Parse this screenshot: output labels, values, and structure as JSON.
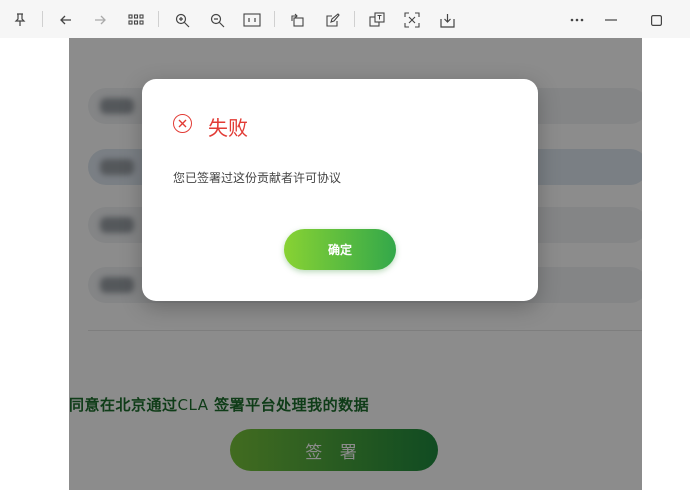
{
  "app": {
    "toolbar_icons": [
      "pin-icon",
      "back-arrow-icon",
      "forward-arrow-icon",
      "grid-icon",
      "zoom-in-icon",
      "zoom-out-icon",
      "actual-size-icon",
      "rotate-icon",
      "edit-icon",
      "translate-icon",
      "ocr-icon",
      "save-icon",
      "more-icon",
      "maximize-icon"
    ]
  },
  "page": {
    "consent_text_prefix": "同意在北京通过",
    "consent_text_cla": "CLA",
    "consent_text_suffix": " 签署平台处理我的数据",
    "sign_button_label": "签 署"
  },
  "dialog": {
    "title": "失败",
    "message": "您已签署过这份贡献者许可协议",
    "confirm_label": "确定",
    "status_color": "#e23b35",
    "icon": "close-circle-icon"
  }
}
